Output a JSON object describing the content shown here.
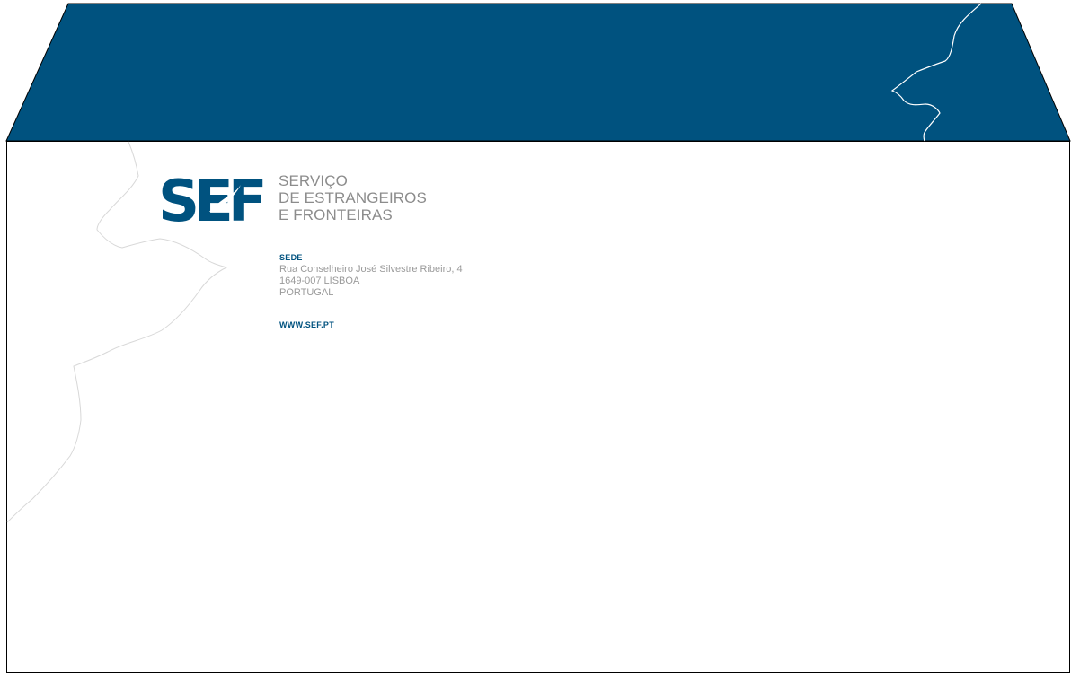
{
  "colors": {
    "flap": "#00527f",
    "outline": "#000000",
    "brand_text": "#8c8c8c",
    "address_text": "#9a9a9a",
    "dove_outline_body": "#d8d8d8",
    "dove_outline_flap": "#ffffff"
  },
  "logo": {
    "mark_text": "SEF",
    "name_lines": [
      "SERVIÇO",
      "DE ESTRANGEIROS",
      "E FRONTEIRAS"
    ]
  },
  "address": {
    "heading": "SEDE",
    "lines": [
      "Rua Conselheiro José Silvestre Ribeiro, 4",
      "1649-007 LISBOA",
      "PORTUGAL"
    ]
  },
  "website": "WWW.SEF.PT",
  "decorations": {
    "flap_icon": "dove-silhouette-icon",
    "body_icon": "dove-silhouette-icon"
  }
}
